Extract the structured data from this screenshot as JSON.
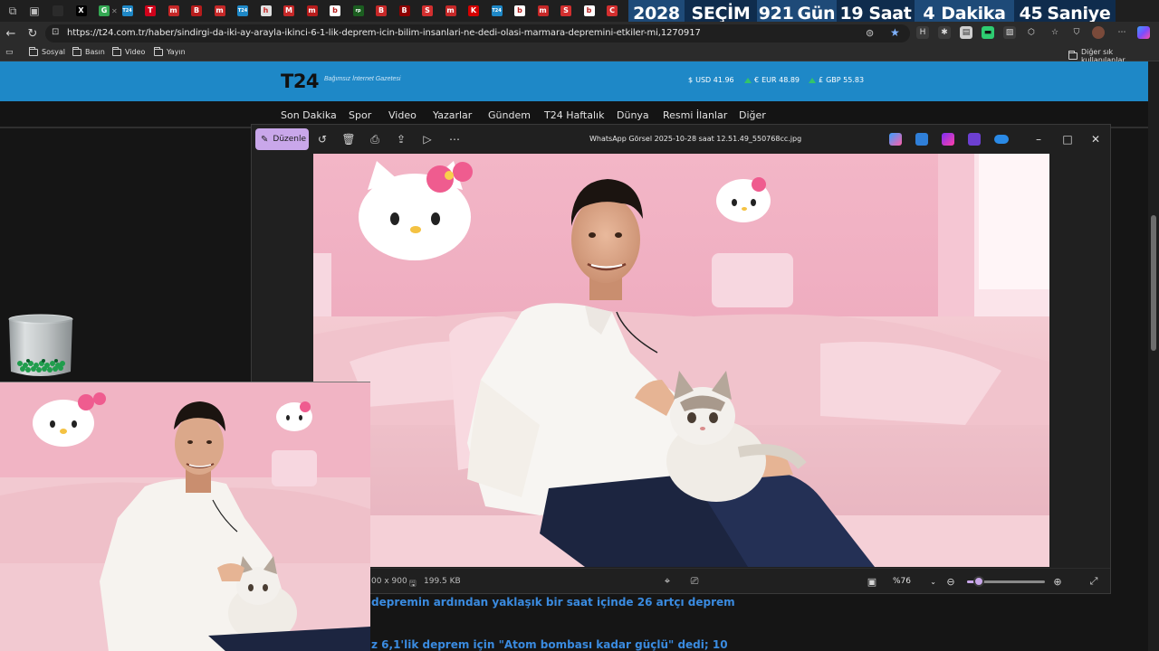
{
  "tabs": [
    {
      "glyph": "",
      "color": "#2b2b2b",
      "text_color": "#bdbdbd"
    },
    {
      "glyph": "X",
      "color": "#000000",
      "text_color": "#ffffff"
    },
    {
      "glyph": "G",
      "color": "#34a853",
      "text_color": "#ffffff",
      "active": true
    },
    {
      "glyph": "T24",
      "color": "#1e88c7",
      "text_color": "#ffffff"
    },
    {
      "glyph": "T",
      "color": "#d0021b",
      "text_color": "#ffffff"
    },
    {
      "glyph": "m",
      "color": "#c62828",
      "text_color": "#ffffff"
    },
    {
      "glyph": "B",
      "color": "#b71c1c",
      "text_color": "#ffffff"
    },
    {
      "glyph": "m",
      "color": "#c62828",
      "text_color": "#ffffff"
    },
    {
      "glyph": "T24",
      "color": "#1e88c7",
      "text_color": "#ffffff"
    },
    {
      "glyph": "h",
      "color": "#e0e0e0",
      "text_color": "#c62828"
    },
    {
      "glyph": "M",
      "color": "#c62828",
      "text_color": "#ffffff"
    },
    {
      "glyph": "m",
      "color": "#b71c1c",
      "text_color": "#ffffff"
    },
    {
      "glyph": "b",
      "color": "#ffffff",
      "text_color": "#b71c1c"
    },
    {
      "glyph": "rp",
      "color": "#1b5e20",
      "text_color": "#ffffff"
    },
    {
      "glyph": "B",
      "color": "#c62828",
      "text_color": "#ffffff"
    },
    {
      "glyph": "B",
      "color": "#8e0000",
      "text_color": "#ffffff"
    },
    {
      "glyph": "S",
      "color": "#d32f2f",
      "text_color": "#ffffff"
    },
    {
      "glyph": "m",
      "color": "#c62828",
      "text_color": "#ffffff"
    },
    {
      "glyph": "K",
      "color": "#d50000",
      "text_color": "#ffffff"
    },
    {
      "glyph": "T24",
      "color": "#1e88c7",
      "text_color": "#ffffff"
    },
    {
      "glyph": "b",
      "color": "#ffffff",
      "text_color": "#b71c1c"
    },
    {
      "glyph": "m",
      "color": "#c62828",
      "text_color": "#ffffff"
    },
    {
      "glyph": "S",
      "color": "#d32f2f",
      "text_color": "#ffffff"
    },
    {
      "glyph": "b",
      "color": "#ffffff",
      "text_color": "#b71c1c"
    },
    {
      "glyph": "C",
      "color": "#d32f2f",
      "text_color": "#ffffff"
    }
  ],
  "countdown": {
    "year": "2028",
    "label": "SEÇİM",
    "days": "921",
    "days_label": "Gün",
    "hours": "19",
    "hours_label": "Saat",
    "minutes": "4",
    "minutes_label": "Dakika",
    "seconds": "45",
    "seconds_label": "Saniye"
  },
  "address_bar": {
    "url": "https://t24.com.tr/haber/sindirgi-da-iki-ay-arayla-ikinci-6-1-lik-deprem-icin-bilim-insanlari-ne-dedi-olasi-marmara-depremini-etkiler-mi,1270917"
  },
  "bookmarks": {
    "items": [
      "Sosyal",
      "Basın",
      "Video",
      "Yayın"
    ],
    "other": "Diğer sık kullanılanlar"
  },
  "site": {
    "logo": "T24",
    "tagline": "Bağımsız İnternet Gazetesi",
    "currencies": [
      {
        "symbol": "$",
        "label": "USD 41.96"
      },
      {
        "symbol": "€",
        "label": "EUR 48.89"
      },
      {
        "symbol": "£",
        "label": "GBP 55.83"
      }
    ],
    "nav": [
      "Son Dakika",
      "Spor",
      "Video",
      "Yazarlar",
      "Gündem",
      "T24 Haftalık",
      "Dünya",
      "Resmi İlanlar",
      "Diğer"
    ],
    "headlines": [
      "depremin ardından yaklaşık bir saat içinde 26 artçı deprem",
      "z 6,1'lik deprem için \"Atom bombası kadar güçlü\" dedi; 10"
    ]
  },
  "viewer": {
    "edit_label": "Düzenle",
    "title": "WhatsApp Görsel 2025-10-28 saat 12.51.49_550768cc.jpg",
    "dimensions": "00 x 900",
    "file_size": "199.5 KB",
    "zoom_label": "%76",
    "zoom_level": 0.15
  },
  "colors": {
    "accent": "#c9a7ea",
    "site_blue": "#1e88c7",
    "headline_blue": "#3a8be0",
    "countdown_navy": "#16395f"
  }
}
